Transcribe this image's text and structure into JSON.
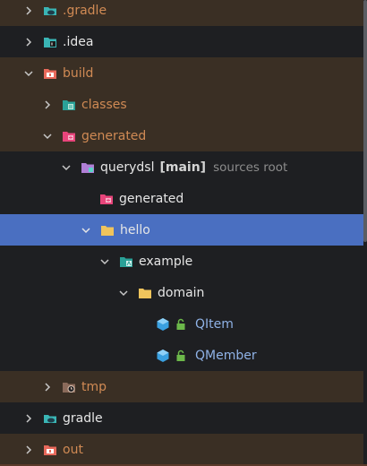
{
  "colors": {
    "excluded_row_bg": "#3a2f24",
    "selected_row_bg": "#4a6fc1",
    "panel_bg": "#1e1f22",
    "excluded_text": "#d08a54",
    "folder_yellow": "#f0c45c",
    "generated_pink": "#e8457b",
    "module_teal": "#3ab5b5"
  },
  "tree": {
    "gradle_hidden": {
      "label": ".gradle",
      "icon": "gradle-folder-icon"
    },
    "idea": {
      "label": ".idea",
      "icon": "idea-folder-icon"
    },
    "build": {
      "label": "build",
      "icon": "excluded-folder-icon"
    },
    "classes": {
      "label": "classes",
      "icon": "classes-folder-icon"
    },
    "generated": {
      "label": "generated",
      "icon": "generated-folder-icon"
    },
    "querydsl": {
      "label": "querydsl",
      "badge": "[main]",
      "hint": "sources root",
      "icon": "source-root-folder-icon"
    },
    "generated_inner": {
      "label": "generated",
      "icon": "generated-folder-icon"
    },
    "hello": {
      "label": "hello",
      "icon": "folder-icon"
    },
    "example": {
      "label": "example",
      "icon": "package-folder-icon"
    },
    "domain": {
      "label": "domain",
      "icon": "folder-icon"
    },
    "qitem": {
      "label": "QItem",
      "icon": "class-icon"
    },
    "qmember": {
      "label": "QMember",
      "icon": "class-icon"
    },
    "tmp": {
      "label": "tmp",
      "icon": "temp-folder-icon"
    },
    "gradle": {
      "label": "gradle",
      "icon": "folder-icon"
    },
    "out": {
      "label": "out",
      "icon": "excluded-folder-icon"
    }
  }
}
